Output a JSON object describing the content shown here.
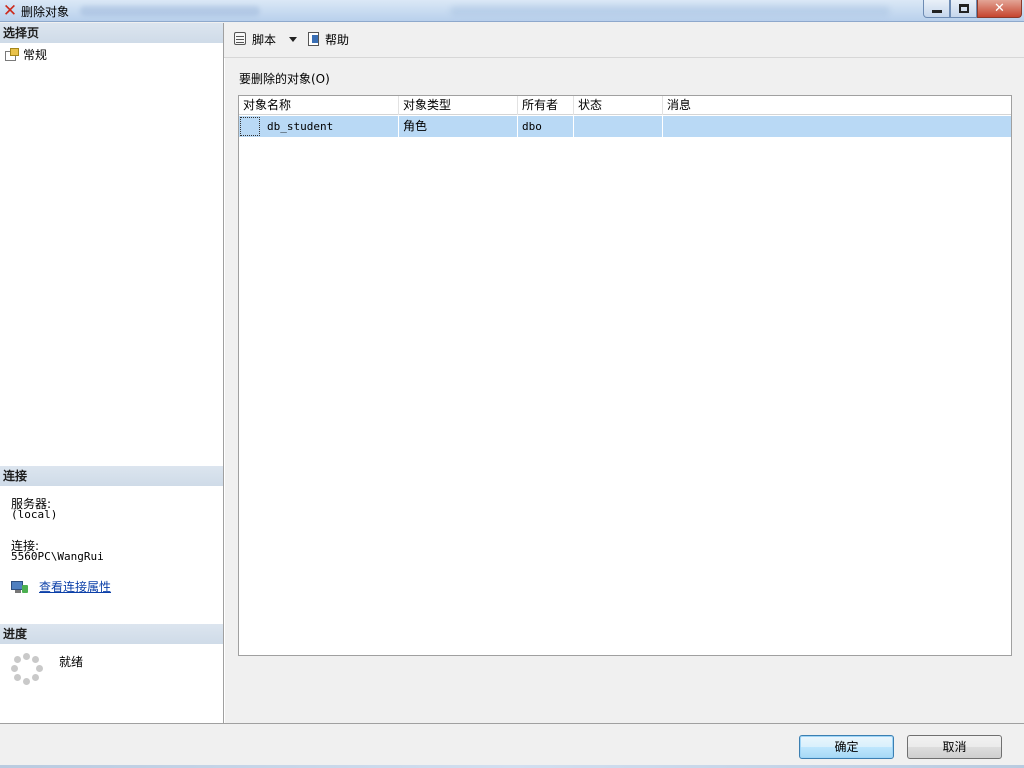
{
  "window": {
    "title": "删除对象",
    "minimize_label": "",
    "maximize_label": "",
    "close_label": "✕"
  },
  "left": {
    "select_page_header": "选择页",
    "pages": [
      {
        "label": "常规",
        "icon": "page-properties-icon"
      }
    ],
    "connection_header": "连接",
    "server_label": "服务器:",
    "server_value": "(local)",
    "connection_label": "连接:",
    "connection_value": "5560PC\\WangRui",
    "view_connection_properties": "查看连接属性",
    "progress_header": "进度",
    "progress_status": "就绪"
  },
  "toolbar": {
    "script_label": "脚本",
    "help_label": "帮助"
  },
  "main": {
    "objects_label": "要删除的对象(O)",
    "columns": [
      "对象名称",
      "对象类型",
      "所有者",
      "状态",
      "消息"
    ],
    "rows": [
      {
        "name": "db_student",
        "type": "角色",
        "owner": "dbo",
        "status": "",
        "message": ""
      }
    ]
  },
  "buttons": {
    "ok": "确定",
    "cancel": "取消"
  },
  "colors": {
    "selected_row": "#b9d9f5",
    "section_header": "#d6e0eb",
    "link": "#0b3fa8"
  }
}
